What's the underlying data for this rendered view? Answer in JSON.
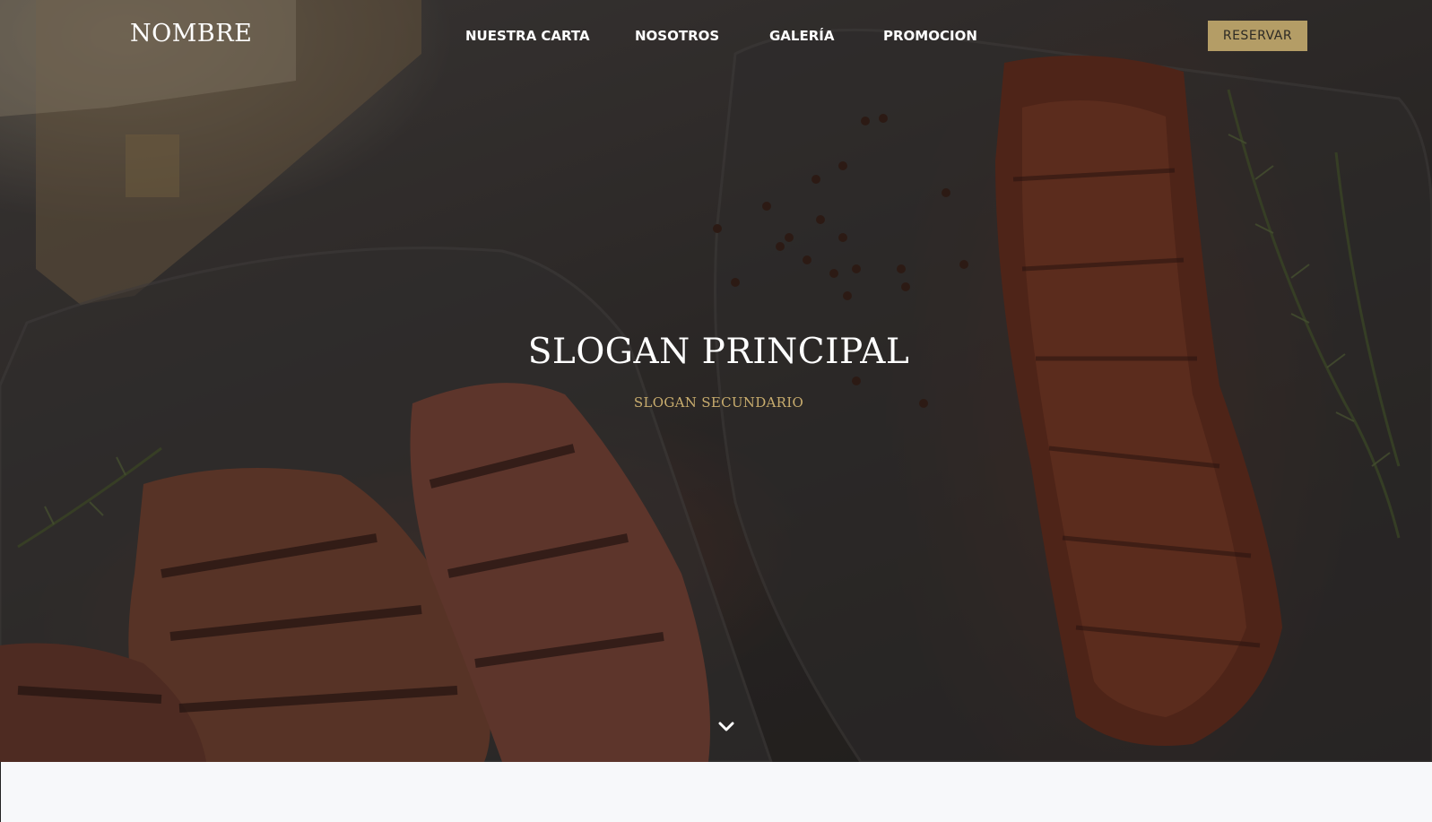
{
  "header": {
    "brand": "NOMBRE",
    "nav": [
      {
        "label": "NUESTRA CARTA"
      },
      {
        "label": "NOSOTROS"
      },
      {
        "label": "GALERÍA"
      },
      {
        "label": "PROMOCION"
      }
    ],
    "reserve_label": "RESERVAR"
  },
  "hero": {
    "title": "SLOGAN PRINCIPAL",
    "subtitle": "SLOGAN SECUNDARIO",
    "scroll_icon": "chevron-down-icon"
  },
  "colors": {
    "accent": "#b49d66",
    "subtitle": "#c9ad6e",
    "nav_text": "#ffffff",
    "background_bottom": "#f7f8fa"
  }
}
